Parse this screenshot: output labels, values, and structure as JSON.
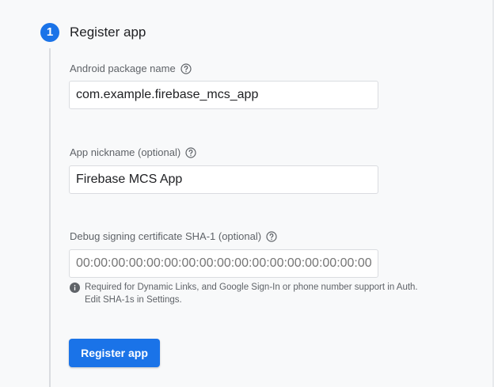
{
  "step": {
    "number": "1",
    "title": "Register app"
  },
  "fields": {
    "package_name": {
      "label": "Android package name",
      "value": "com.example.firebase_mcs_app"
    },
    "nickname": {
      "label": "App nickname (optional)",
      "value": "Firebase MCS App"
    },
    "sha1": {
      "label": "Debug signing certificate SHA-1 (optional)",
      "placeholder": "00:00:00:00:00:00:00:00:00:00:00:00:00:00:00:00:00:00:00:00"
    }
  },
  "hint": {
    "line1": "Required for Dynamic Links, and Google Sign-In or phone number support in Auth.",
    "line2": "Edit SHA-1s in Settings."
  },
  "actions": {
    "register_label": "Register app"
  },
  "colors": {
    "accent": "#1a73e8",
    "background": "#f8f9fa",
    "text_primary": "#202124",
    "text_secondary": "#5f6368",
    "border": "#dadce0"
  },
  "icons": {
    "help": "help-circle-icon",
    "info": "info-icon"
  }
}
